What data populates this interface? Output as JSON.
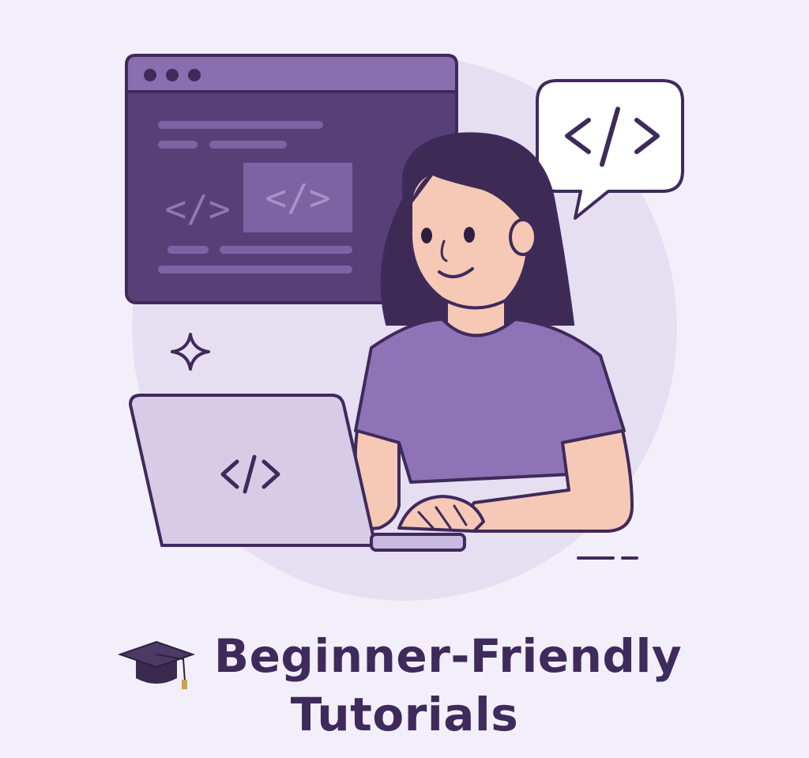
{
  "title": {
    "line1": "Beginner-Friendly",
    "line2": "Tutorials",
    "icon": "graduation-cap-icon"
  },
  "illustration": {
    "code_glyph": "</>",
    "icons": [
      "code-window-icon",
      "speech-bubble-code-icon",
      "sparkle-icon",
      "laptop-icon"
    ]
  },
  "colors": {
    "background": "#f3effa",
    "circle": "#e4ddf1",
    "window_dark": "#574078",
    "window_bar": "#8a6fb0",
    "outline": "#3f2a5c",
    "shirt": "#8e74b6",
    "skin": "#f5c9b6",
    "hair": "#3d2a55",
    "laptop": "#d6cce6",
    "accent_text": "#3f2a5c"
  }
}
